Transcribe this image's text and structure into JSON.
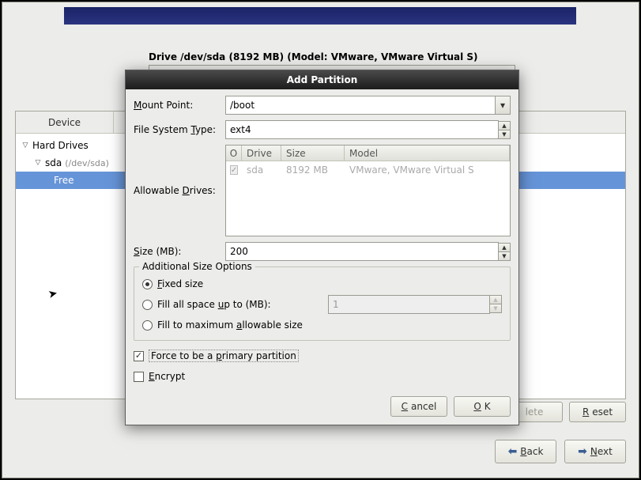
{
  "main": {
    "drive_info": "Drive /dev/sda (8192 MB) (Model: VMware, VMware Virtual S)",
    "device_header": "Device",
    "tree": {
      "root": "Hard Drives",
      "disk": "sda",
      "disk_path": "(/dev/sda)",
      "free": "Free"
    },
    "buttons": {
      "delete_end": "lete",
      "reset_u": "R",
      "reset_rest": "eset"
    },
    "nav": {
      "back_u": "B",
      "back_rest": "ack",
      "next_u": "N",
      "next_rest": "ext"
    }
  },
  "dialog": {
    "title": "Add Partition",
    "labels": {
      "mount_u": "M",
      "mount_rest": "ount Point:",
      "fs_u": "T",
      "fs_pre": "File System ",
      "fs_rest": "ype:",
      "allow_u": "D",
      "allow_pre": "Allowable ",
      "allow_rest": "rives:",
      "size_u": "S",
      "size_rest": "ize (MB):",
      "group": "Additional Size Options",
      "fixed_u": "F",
      "fixed_rest": "ixed size",
      "fillup_pre": "Fill all space ",
      "fillup_u": "u",
      "fillup_rest": "p to (MB):",
      "fillmax_pre": "Fill to maximum ",
      "fillmax_u": "a",
      "fillmax_rest": "llowable size",
      "primary_pre": "Force to be a ",
      "primary_u": "p",
      "primary_rest": "rimary partition",
      "encrypt_u": "E",
      "encrypt_rest": "ncrypt",
      "cancel_u": "C",
      "cancel_rest": "ancel",
      "ok_u": "O",
      "ok_rest": "K"
    },
    "values": {
      "mount": "/boot",
      "fs": "ext4",
      "size": "200",
      "fillup_val": "1"
    },
    "drives_table": {
      "headers": {
        "chk": "O",
        "drive": "Drive",
        "size": "Size",
        "model": "Model"
      },
      "row": {
        "drive": "sda",
        "size": "8192 MB",
        "model": "VMware, VMware Virtual S"
      }
    }
  }
}
